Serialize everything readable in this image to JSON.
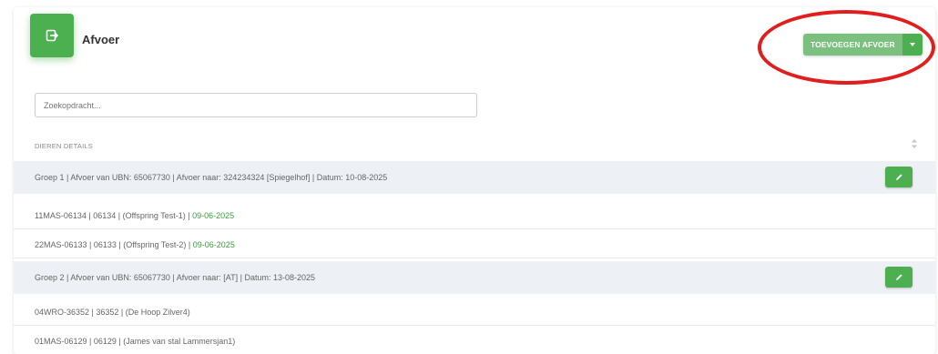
{
  "header": {
    "title": "Afvoer",
    "icon": "exit-icon",
    "add_button_label": "TOEVOEGEN AFVOER",
    "add_dropdown_icon": "caret-down-icon"
  },
  "search": {
    "placeholder": "Zoekopdracht..."
  },
  "table": {
    "column_header": "DIEREN DETAILS",
    "rows": [
      {
        "type": "group",
        "text": "Groep 1 | Afvoer van UBN: 65067730 | Afvoer naar: 324234324 [Spiegelhof] | Datum: 10-08-2025"
      },
      {
        "type": "item",
        "text": "11MAS-06134 | 06134 | (Offspring Test-1) | ",
        "date": "09-06-2025"
      },
      {
        "type": "item",
        "text": "22MAS-06133 | 06133 | (Offspring Test-2) | ",
        "date": "09-06-2025"
      },
      {
        "type": "group",
        "text": "Groep 2 | Afvoer van UBN: 65067730 | Afvoer naar: [AT] | Datum: 13-08-2025"
      },
      {
        "type": "item",
        "text": "04WRO-36352 | 36352 | (De Hoop Zilver4)",
        "date": ""
      },
      {
        "type": "item",
        "text": "01MAS-06129 | 06129 | (James van stal Lammersjan1)",
        "date": ""
      }
    ]
  },
  "colors": {
    "accent_green": "#4caf50",
    "light_green": "#7bc07f",
    "annotation_red": "#e01e1e",
    "group_row_bg": "#edf0f4"
  }
}
